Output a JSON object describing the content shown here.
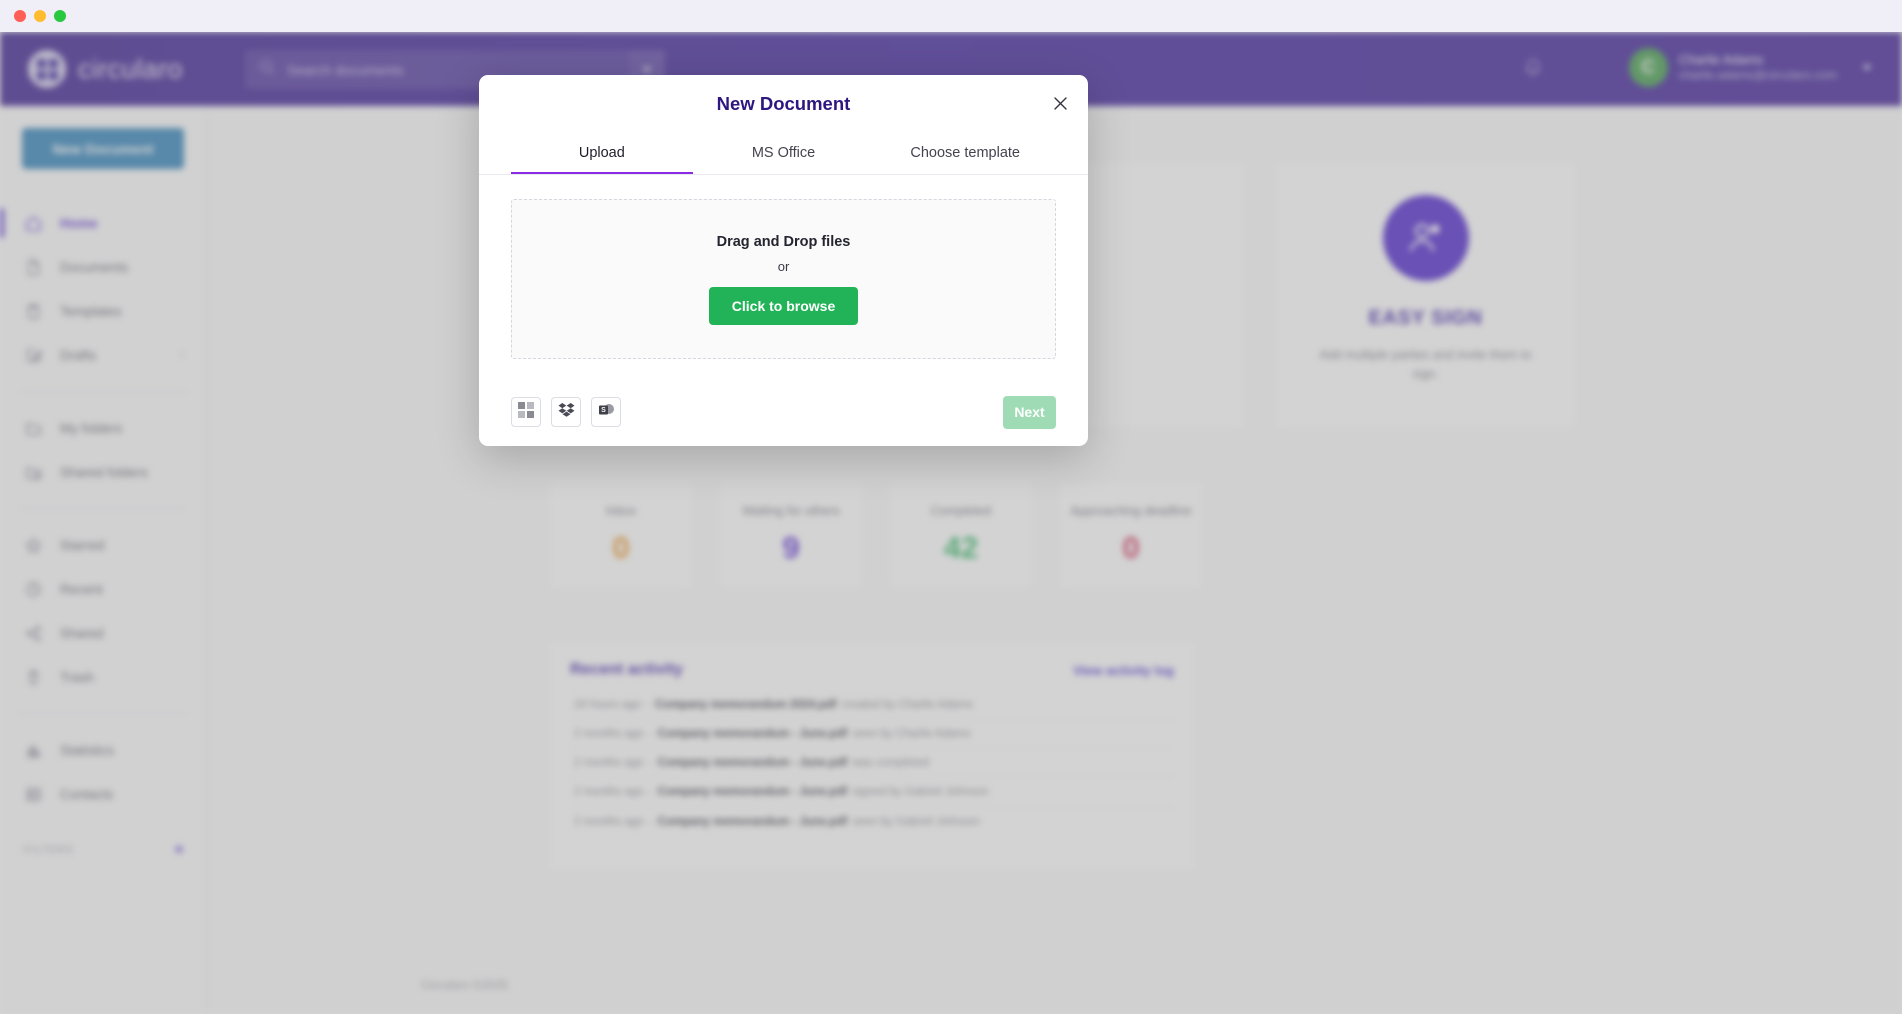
{
  "window": {
    "traffic_lights": [
      "close",
      "minimize",
      "maximize"
    ]
  },
  "topbar": {
    "brand": "circularo",
    "search": {
      "placeholder": "Search documents",
      "value": ""
    },
    "bell_icon": "bell-icon",
    "user": {
      "initial": "C",
      "name": "Charlie Adams",
      "email": "charlie.adams@circularo.com"
    }
  },
  "sidebar": {
    "new_document_label": "New Document",
    "groups": [
      {
        "items": [
          {
            "label": "Home",
            "icon": "home-icon",
            "active": true
          },
          {
            "label": "Documents",
            "icon": "document-icon",
            "active": false
          },
          {
            "label": "Templates",
            "icon": "template-icon",
            "active": false
          },
          {
            "label": "Drafts",
            "icon": "draft-edit-icon",
            "active": false,
            "chevron": "›"
          }
        ]
      },
      {
        "items": [
          {
            "label": "My folders",
            "icon": "folder-icon",
            "active": false
          },
          {
            "label": "Shared folders",
            "icon": "shared-folder-icon",
            "active": false
          }
        ]
      },
      {
        "items": [
          {
            "label": "Starred",
            "icon": "star-icon",
            "active": false
          },
          {
            "label": "Recent",
            "icon": "clock-icon",
            "active": false
          },
          {
            "label": "Shared",
            "icon": "share-icon",
            "active": false
          },
          {
            "label": "Trash",
            "icon": "trash-icon",
            "active": false
          }
        ]
      },
      {
        "items": [
          {
            "label": "Statistics",
            "icon": "chart-icon",
            "active": false
          },
          {
            "label": "Contacts",
            "icon": "contacts-icon",
            "active": false
          }
        ]
      }
    ],
    "filters": {
      "label": "FILTERS",
      "add": "+"
    }
  },
  "main": {
    "promo_cards": [
      {
        "title": "EASY SIGN",
        "description": "Add multiple parties and invite them to sign.",
        "icon": "people-sign-icon"
      }
    ],
    "stats": [
      {
        "label": "Inbox",
        "value": "0",
        "color": "#e8962c"
      },
      {
        "label": "Waiting for others",
        "value": "9",
        "color": "#5b2bd4"
      },
      {
        "label": "Completed",
        "value": "42",
        "color": "#2eb562"
      },
      {
        "label": "Approaching deadline",
        "value": "0",
        "color": "#d1365f"
      }
    ],
    "activity": {
      "title": "Recent activity",
      "link": "View activity log",
      "rows": [
        {
          "time": "24 hours ago",
          "dash": "-",
          "file": "Company memorandum 2024.pdf",
          "action": "created by Charlie Adams"
        },
        {
          "time": "2 months ago",
          "dash": "-",
          "file": "Company memorandum - June.pdf",
          "action": "seen by Charlie Adams"
        },
        {
          "time": "2 months ago",
          "dash": "-",
          "file": "Company memorandum - June.pdf",
          "action": "was completed"
        },
        {
          "time": "2 months ago",
          "dash": "-",
          "file": "Company memorandum - June.pdf",
          "action": "signed by Gabriel Johnson"
        },
        {
          "time": "2 months ago",
          "dash": "-",
          "file": "Company memorandum - June.pdf",
          "action": "seen by Gabriel Johnson"
        }
      ]
    },
    "footer": "Circularo ©2025"
  },
  "modal": {
    "title": "New Document",
    "close_icon": "close-icon",
    "tabs": [
      {
        "label": "Upload",
        "active": true
      },
      {
        "label": "MS Office",
        "active": false
      },
      {
        "label": "Choose template",
        "active": false
      }
    ],
    "dropzone": {
      "title": "Drag and Drop files",
      "or": "or",
      "browse_label": "Click to browse"
    },
    "services": [
      {
        "name": "google-drive-icon"
      },
      {
        "name": "dropbox-icon"
      },
      {
        "name": "sharepoint-icon"
      }
    ],
    "next_label": "Next"
  },
  "colors": {
    "brand_purple": "#3a1d9b",
    "accent_purple": "#5b2bd4",
    "green": "#22b358",
    "blue_button": "#2b7fb8"
  }
}
